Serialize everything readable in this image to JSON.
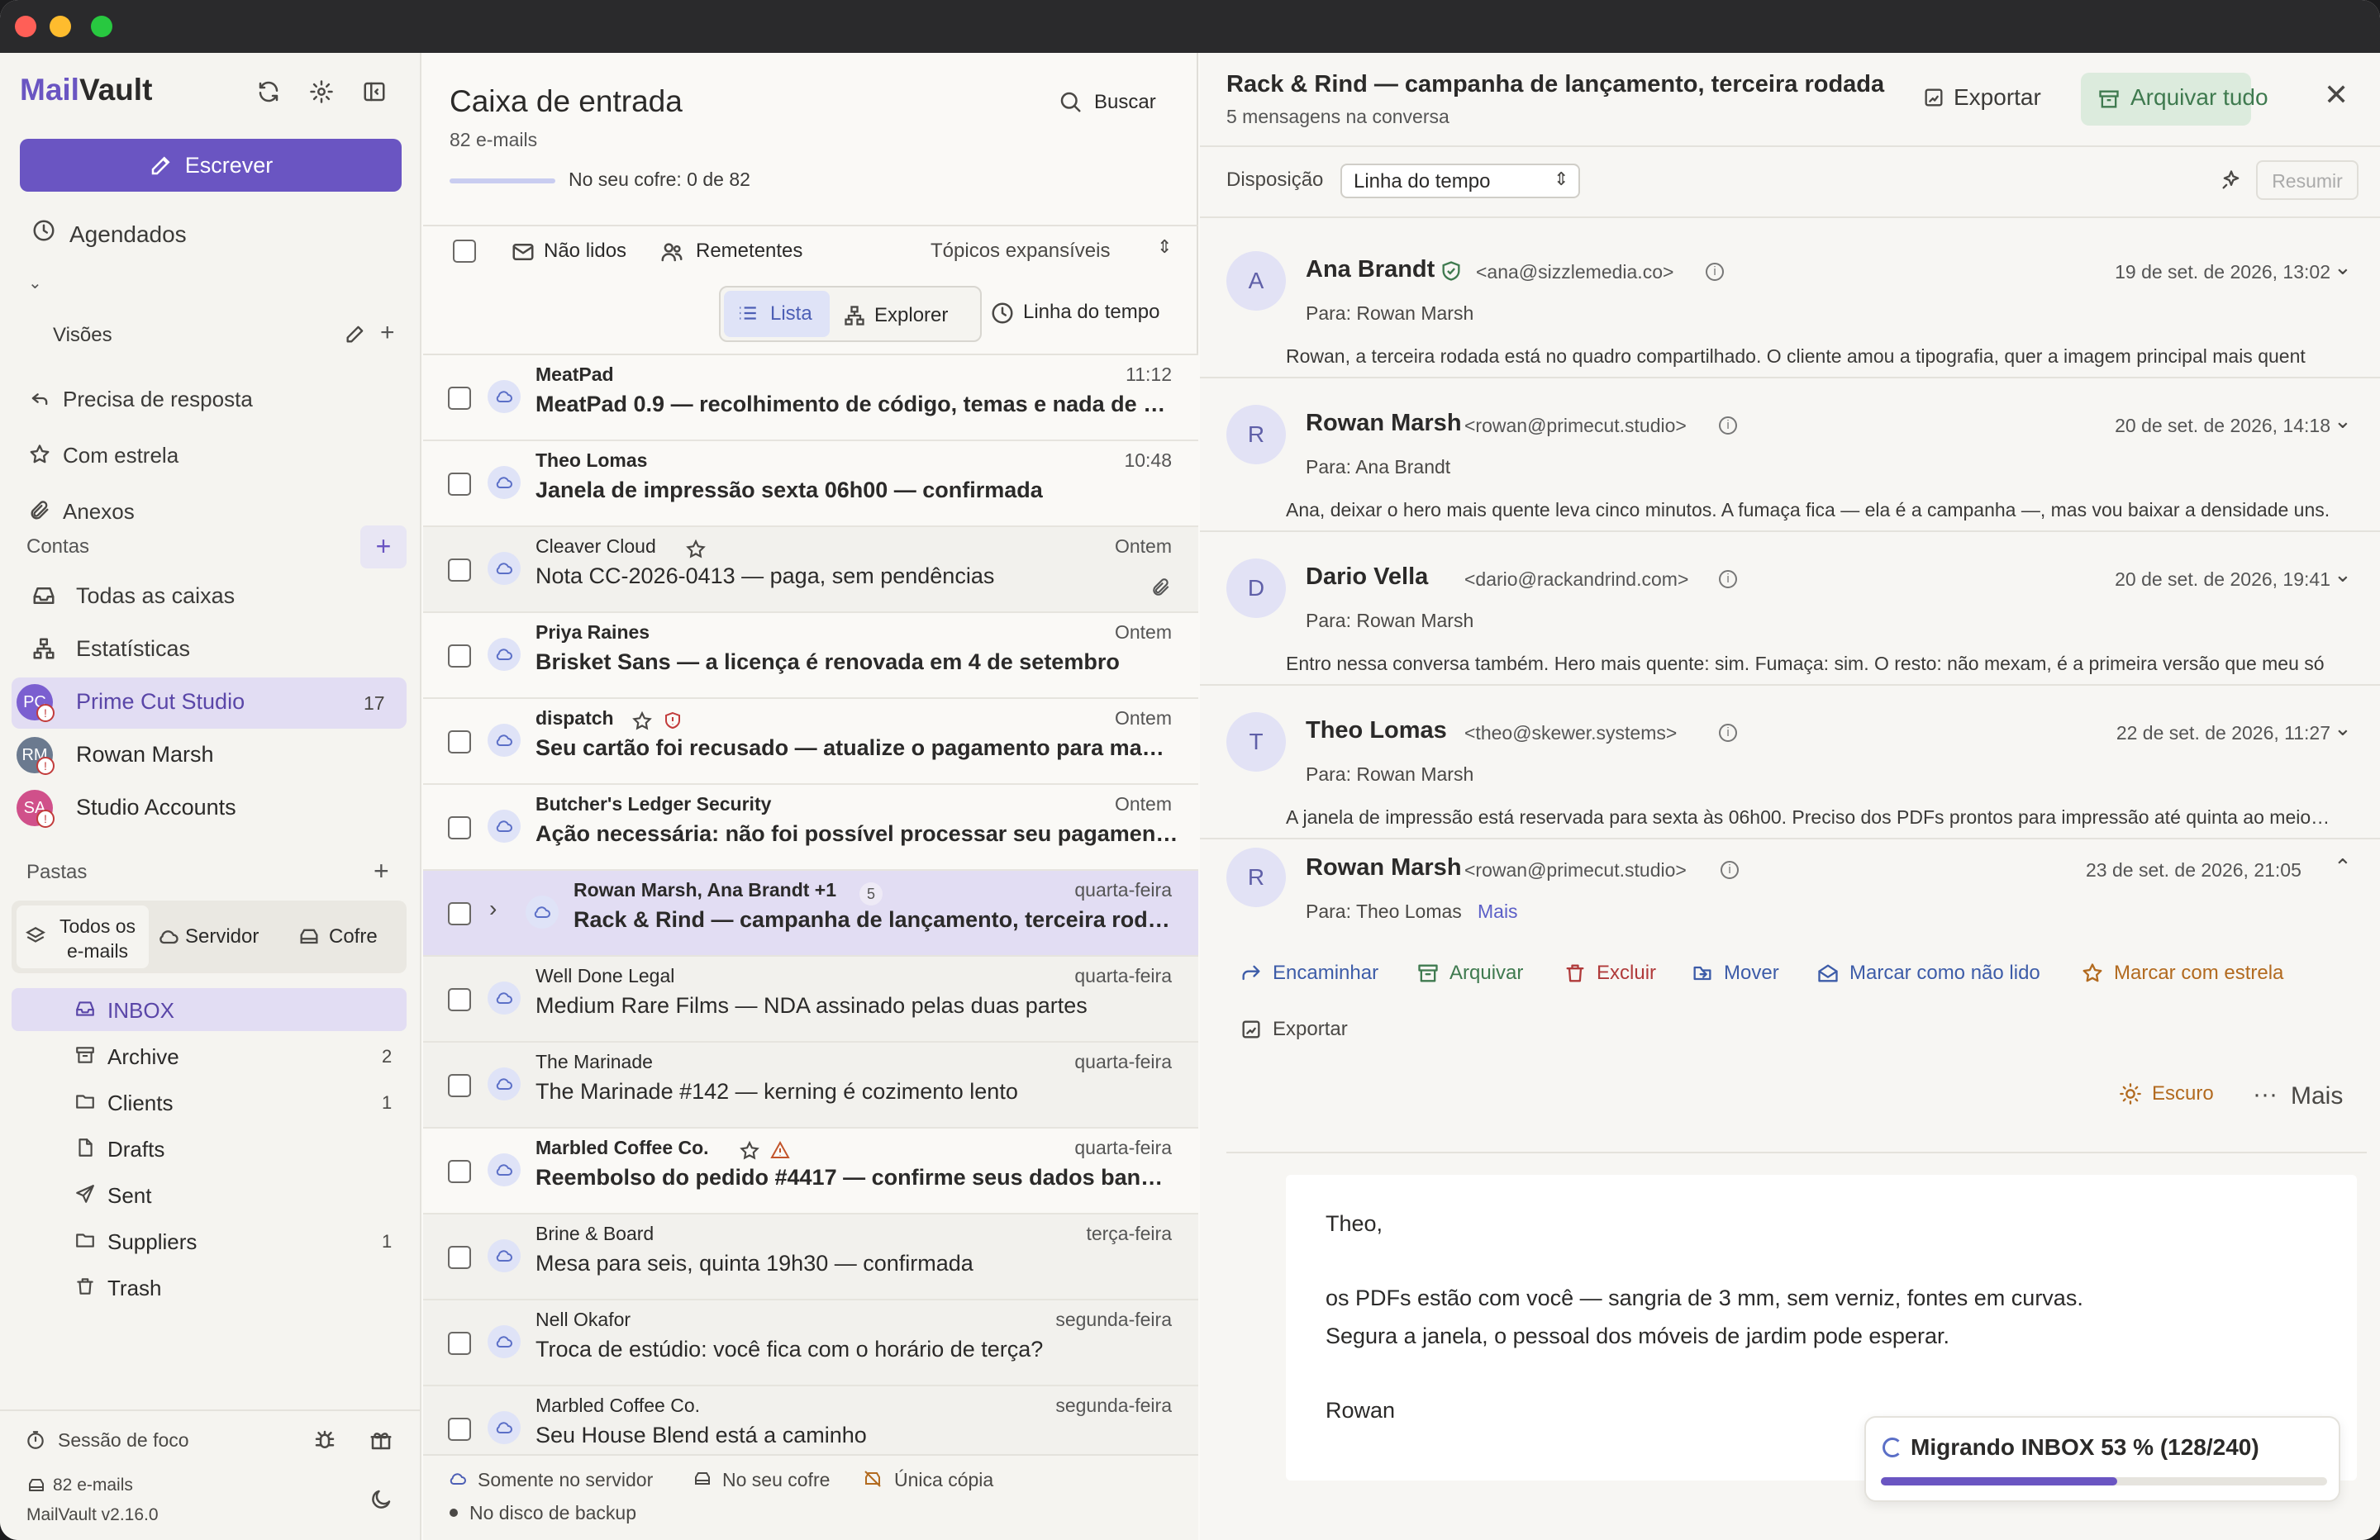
{
  "app": {
    "brand_prefix": "Mail",
    "brand_suffix": "Vault"
  },
  "sidebar": {
    "compose_label": "Escrever",
    "scheduled_label": "Agendados",
    "views_label": "Visões",
    "views": [
      {
        "label": "Precisa de resposta",
        "icon": "reply-icon"
      },
      {
        "label": "Com estrela",
        "icon": "star-icon"
      },
      {
        "label": "Anexos",
        "icon": "paperclip-icon"
      }
    ],
    "accounts_label": "Contas",
    "accounts_top": [
      {
        "label": "Todas as caixas",
        "icon": "inbox-icon"
      },
      {
        "label": "Estatísticas",
        "icon": "stats-icon"
      }
    ],
    "accounts": [
      {
        "label": "Prime Cut Studio",
        "initials": "PC",
        "count": "17",
        "color": "#7b5fd0"
      },
      {
        "label": "Rowan Marsh",
        "initials": "RM",
        "count": "",
        "color": "#6b7a8f"
      },
      {
        "label": "Studio Accounts",
        "initials": "SA",
        "count": "",
        "color": "#d0508a"
      }
    ],
    "folders_label": "Pastas",
    "folder_tabs": [
      "Todos os e-mails",
      "Servidor",
      "Cofre"
    ],
    "folders": [
      {
        "label": "INBOX",
        "count": "",
        "icon": "inbox-icon"
      },
      {
        "label": "Archive",
        "count": "2",
        "icon": "archive-icon"
      },
      {
        "label": "Clients",
        "count": "1",
        "icon": "folder-icon"
      },
      {
        "label": "Drafts",
        "count": "",
        "icon": "file-icon"
      },
      {
        "label": "Sent",
        "count": "",
        "icon": "send-icon"
      },
      {
        "label": "Suppliers",
        "count": "1",
        "icon": "folder-icon"
      },
      {
        "label": "Trash",
        "count": "",
        "icon": "trash-icon"
      }
    ],
    "focus_label": "Sessão de foco",
    "email_count": "82 e-mails",
    "version": "MailVault v2.16.0"
  },
  "list": {
    "title": "Caixa de entrada",
    "subtitle": "82 e-mails",
    "search_label": "Buscar",
    "vault_progress_label": "No seu cofre: 0 de 82",
    "vault_progress": 0,
    "filter_unread": "Não lidos",
    "filter_senders": "Remetentes",
    "filter_topics": "Tópicos expansíveis",
    "view_list": "Lista",
    "view_explorer": "Explorer",
    "view_timeline": "Linha do tempo",
    "messages": [
      {
        "sender": "MeatPad",
        "subject": "MeatPad 0.9 — recolhimento de código, temas e nada de …",
        "time": "11:12",
        "unread": true,
        "star": false,
        "shield": false,
        "warn": false,
        "clip": false,
        "count": ""
      },
      {
        "sender": "Theo Lomas",
        "subject": "Janela de impressão sexta 06h00 — confirmada",
        "time": "10:48",
        "unread": true,
        "star": false,
        "shield": false,
        "warn": false,
        "clip": false,
        "count": ""
      },
      {
        "sender": "Cleaver Cloud",
        "subject": "Nota CC-2026-0413 — paga, sem pendências",
        "time": "Ontem",
        "unread": false,
        "star": true,
        "shield": false,
        "warn": false,
        "clip": true,
        "count": ""
      },
      {
        "sender": "Priya Raines",
        "subject": "Brisket Sans — a licença é renovada em 4 de setembro",
        "time": "Ontem",
        "unread": true,
        "star": false,
        "shield": false,
        "warn": false,
        "clip": false,
        "count": ""
      },
      {
        "sender": "dispatch",
        "subject": "Seu cartão foi recusado — atualize o pagamento para ma…",
        "time": "Ontem",
        "unread": true,
        "star": true,
        "shield": true,
        "warn": false,
        "clip": false,
        "count": ""
      },
      {
        "sender": "Butcher's Ledger Security",
        "subject": "Ação necessária: não foi possível processar seu pagamen…",
        "time": "Ontem",
        "unread": true,
        "star": false,
        "shield": false,
        "warn": false,
        "clip": false,
        "count": ""
      },
      {
        "sender": "Rowan Marsh, Ana Brandt +1",
        "subject": "Rack & Rind — campanha de lançamento, terceira rod…",
        "time": "quarta-feira",
        "unread": true,
        "star": false,
        "shield": false,
        "warn": false,
        "clip": false,
        "count": "5",
        "selected": true
      },
      {
        "sender": "Well Done Legal",
        "subject": "Medium Rare Films — NDA assinado pelas duas partes",
        "time": "quarta-feira",
        "unread": false,
        "star": false,
        "shield": false,
        "warn": false,
        "clip": false,
        "count": ""
      },
      {
        "sender": "The Marinade",
        "subject": "The Marinade #142 — kerning é cozimento lento",
        "time": "quarta-feira",
        "unread": false,
        "star": false,
        "shield": false,
        "warn": false,
        "clip": false,
        "count": ""
      },
      {
        "sender": "Marbled Coffee Co.",
        "subject": "Reembolso do pedido #4417 — confirme seus dados ban…",
        "time": "quarta-feira",
        "unread": true,
        "star": true,
        "shield": false,
        "warn": true,
        "clip": false,
        "count": ""
      },
      {
        "sender": "Brine & Board",
        "subject": "Mesa para seis, quinta 19h30 — confirmada",
        "time": "terça-feira",
        "unread": false,
        "star": false,
        "shield": false,
        "warn": false,
        "clip": false,
        "count": ""
      },
      {
        "sender": "Nell Okafor",
        "subject": "Troca de estúdio: você fica com o horário de terça?",
        "time": "segunda-feira",
        "unread": false,
        "star": false,
        "shield": false,
        "warn": false,
        "clip": false,
        "count": ""
      },
      {
        "sender": "Marbled Coffee Co.",
        "subject": "Seu House Blend está a caminho",
        "time": "segunda-feira",
        "unread": false,
        "star": false,
        "shield": false,
        "warn": false,
        "clip": false,
        "count": ""
      }
    ],
    "legend_server": "Somente no servidor",
    "legend_vault": "No seu cofre",
    "legend_single": "Única cópia",
    "legend_backup": "No disco de backup"
  },
  "reader": {
    "title": "Rack & Rind — campanha de lançamento, terceira rodada",
    "subtitle": "5 mensagens na conversa",
    "export_label": "Exportar",
    "archive_all_label": "Arquivar tudo",
    "layout_label": "Disposição",
    "layout_value": "Linha do tempo",
    "summarize_label": "Resumir",
    "messages": [
      {
        "initial": "A",
        "name": "Ana Brandt",
        "verified": true,
        "email": "<ana@sizzlemedia.co>",
        "date": "19 de set. de 2026, 13:02",
        "to": "Para: Rowan Marsh",
        "preview": "Rowan,  a terceira rodada está no quadro compartilhado. O cliente amou a tipografia, quer a imagem principal mais quent"
      },
      {
        "initial": "R",
        "name": "Rowan Marsh",
        "verified": false,
        "email": "<rowan@primecut.studio>",
        "date": "20 de set. de 2026, 14:18",
        "to": "Para: Ana Brandt",
        "preview": "Ana,  deixar o hero mais quente leva cinco minutos. A fumaça fica — ela é a campanha —, mas vou baixar a densidade uns."
      },
      {
        "initial": "D",
        "name": "Dario Vella",
        "verified": false,
        "email": "<dario@rackandrind.com>",
        "date": "20 de set. de 2026, 19:41",
        "to": "Para: Rowan Marsh",
        "preview": "Entro nessa conversa também.  Hero mais quente: sim. Fumaça: sim. O resto: não mexam, é a primeira versão que meu só"
      },
      {
        "initial": "T",
        "name": "Theo Lomas",
        "verified": false,
        "email": "<theo@skewer.systems>",
        "date": "22 de set. de 2026, 11:27",
        "to": "Para: Rowan Marsh",
        "preview": "A janela de impressão está reservada para sexta às 06h00. Preciso dos PDFs prontos para impressão até quinta ao meio…"
      }
    ],
    "open": {
      "initial": "R",
      "name": "Rowan Marsh",
      "email": "<rowan@primecut.studio>",
      "date": "23 de set. de 2026, 21:05",
      "to": "Para: Theo Lomas",
      "more_link": "Mais",
      "actions": [
        "Encaminhar",
        "Arquivar",
        "Excluir",
        "Mover",
        "Marcar como não lido",
        "Marcar com estrela",
        "Exportar"
      ],
      "dark_label": "Escuro",
      "more_label": "Mais",
      "body": [
        "Theo,",
        "os PDFs estão com você — sangria de 3 mm, sem verniz, fontes em curvas.",
        "Segura a janela, o pessoal dos móveis de jardim pode esperar.",
        "Rowan"
      ]
    },
    "migration": {
      "label": "Migrando INBOX 53 % (128/240)",
      "progress": 0.53
    }
  },
  "colors": {
    "accent": "#6a55c2",
    "selected": "#e2ddf3",
    "archive_green": "#3f7a4f",
    "delete_red": "#b03a3a",
    "move_blue": "#3d5ca8",
    "star_orange": "#b26a1f"
  }
}
